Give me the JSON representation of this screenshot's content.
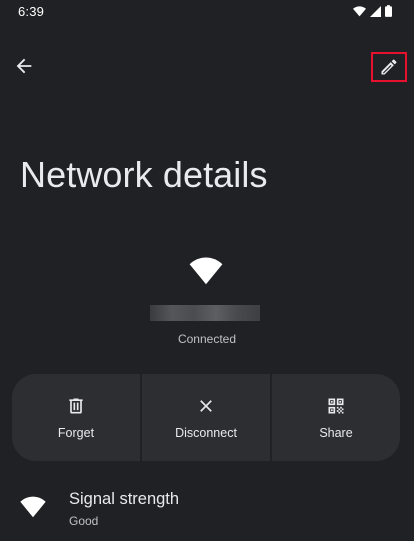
{
  "status_bar": {
    "time": "6:39",
    "icons": [
      "wifi-icon",
      "cellular-signal-icon",
      "battery-icon"
    ]
  },
  "toolbar": {
    "back_icon": "arrow-back-icon",
    "edit_icon": "pencil-icon"
  },
  "page": {
    "title": "Network details"
  },
  "network": {
    "icon": "wifi-full-icon",
    "status": "Connected"
  },
  "actions": [
    {
      "label": "Forget",
      "icon": "trash-icon"
    },
    {
      "label": "Disconnect",
      "icon": "close-icon"
    },
    {
      "label": "Share",
      "icon": "qr-code-icon"
    }
  ],
  "preferences": [
    {
      "title": "Signal strength",
      "summary": "Good",
      "icon": "wifi-icon"
    }
  ],
  "colors": {
    "background": "#202124",
    "surface": "#2d2e31",
    "text_primary": "#e8eaed",
    "text_secondary": "#bdc1c6",
    "highlight": "#e8112d"
  }
}
